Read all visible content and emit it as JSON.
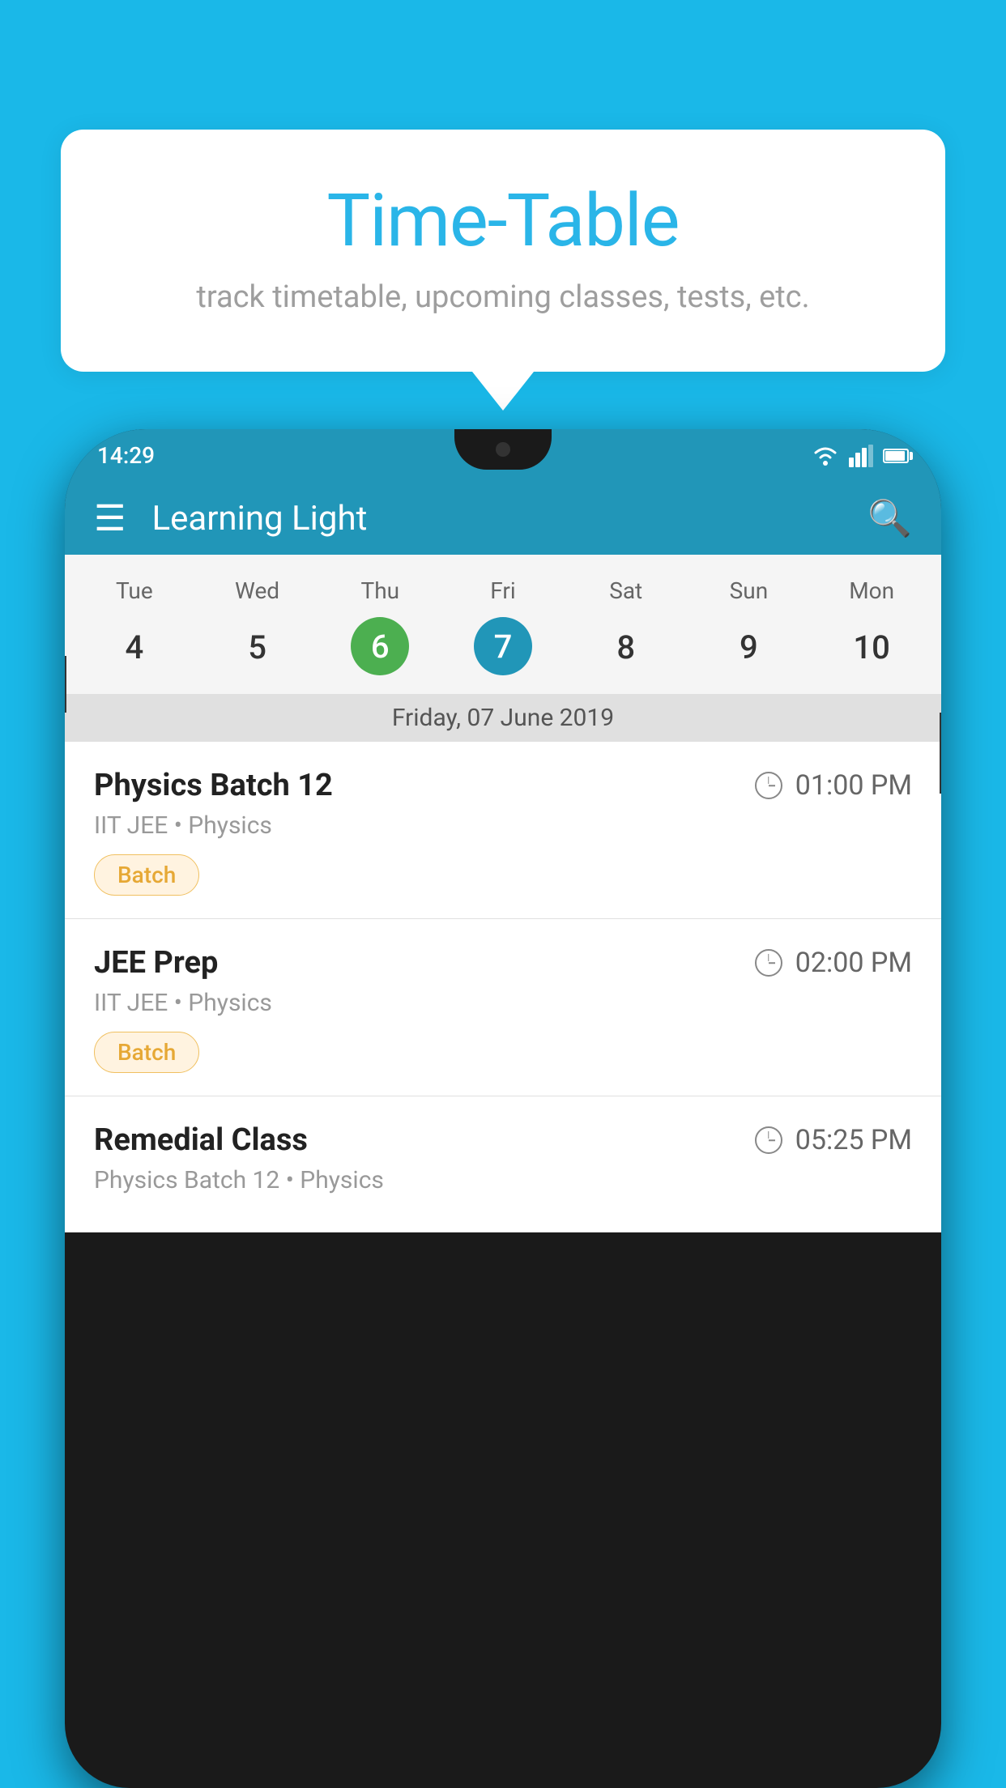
{
  "background": {
    "color": "#1ab8e8"
  },
  "tooltip": {
    "title": "Time-Table",
    "subtitle": "track timetable, upcoming classes, tests, etc."
  },
  "phone": {
    "statusBar": {
      "time": "14:29"
    },
    "appBar": {
      "title": "Learning Light"
    },
    "calendar": {
      "days": [
        {
          "label": "Tue",
          "num": "4"
        },
        {
          "label": "Wed",
          "num": "5"
        },
        {
          "label": "Thu",
          "num": "6",
          "isToday": true
        },
        {
          "label": "Fri",
          "num": "7",
          "isSelected": true
        },
        {
          "label": "Sat",
          "num": "8"
        },
        {
          "label": "Sun",
          "num": "9"
        },
        {
          "label": "Mon",
          "num": "10"
        }
      ],
      "currentDate": "Friday, 07 June 2019"
    },
    "schedule": [
      {
        "title": "Physics Batch 12",
        "time": "01:00 PM",
        "subtitle": "IIT JEE • Physics",
        "tag": "Batch"
      },
      {
        "title": "JEE Prep",
        "time": "02:00 PM",
        "subtitle": "IIT JEE • Physics",
        "tag": "Batch"
      },
      {
        "title": "Remedial Class",
        "time": "05:25 PM",
        "subtitle": "Physics Batch 12 • Physics",
        "tag": null
      }
    ]
  }
}
